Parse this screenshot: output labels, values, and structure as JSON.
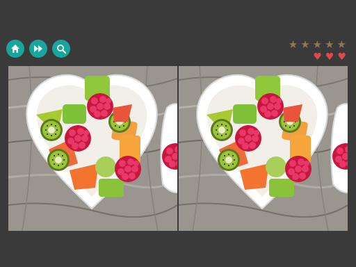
{
  "toolbar": {
    "buttons": [
      {
        "name": "home-button",
        "icon": "home-icon"
      },
      {
        "name": "skip-button",
        "icon": "fast-forward-icon"
      },
      {
        "name": "hint-button",
        "icon": "magnifier-icon"
      }
    ]
  },
  "status": {
    "stars_total": 5,
    "stars_earned": 0,
    "lives_total": 3,
    "lives_remaining": 3
  },
  "colors": {
    "background": "#3a3a3a",
    "button": "#18a59b",
    "star_inactive": "#8a7a55",
    "heart": "#e0484f"
  },
  "puzzle": {
    "panels": [
      "left-image",
      "right-image"
    ]
  }
}
